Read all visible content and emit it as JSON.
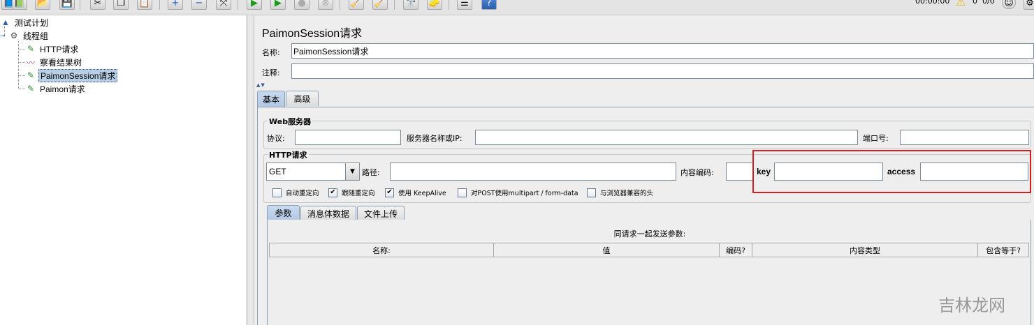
{
  "toolbar": {
    "buttons": [
      "templates-icon",
      "open-icon",
      "save-icon",
      "cut-icon",
      "copy-icon",
      "paste-icon",
      "expand-icon",
      "collapse-icon",
      "toggle-icon",
      "start-icon",
      "start-no-pause-icon",
      "stop-icon",
      "shutdown-icon",
      "clear-icon",
      "clear-all-icon",
      "search-icon",
      "reset-search-icon",
      "function-helper-icon",
      "help-icon"
    ],
    "timer": "00:00:00",
    "warning_count": "0",
    "thread_status": "0/0"
  },
  "tree": {
    "nodes": [
      {
        "label": "测试计划",
        "icon": "test-plan-icon"
      },
      {
        "label": "线程组",
        "icon": "gear-icon"
      },
      {
        "label": "HTTP请求",
        "icon": "pipette-icon"
      },
      {
        "label": "察看结果树",
        "icon": "chart-icon"
      },
      {
        "label": "PaimonSession请求",
        "icon": "pipette-icon",
        "selected": true
      },
      {
        "label": "Paimon请求",
        "icon": "pipette-icon"
      }
    ]
  },
  "panel": {
    "title": "PaimonSession请求",
    "name_label": "名称:",
    "name_value": "PaimonSession请求",
    "comment_label": "注释:",
    "comment_value": ""
  },
  "tabs": [
    "基本",
    "高级"
  ],
  "web_server": {
    "title": "Web服务器",
    "protocol_label": "协议:",
    "server_label": "服务器名称或IP:",
    "port_label": "端口号:"
  },
  "http_request": {
    "title": "HTTP请求",
    "method": "GET",
    "path_label": "路径:",
    "encoding_label": "内容编码:",
    "key_label": "key",
    "access_label": "access"
  },
  "checkboxes": [
    {
      "label": "自动重定向",
      "checked": false
    },
    {
      "label": "跟随重定向",
      "checked": true
    },
    {
      "label": "使用 KeepAlive",
      "checked": true
    },
    {
      "label": "对POST使用multipart / form-data",
      "checked": false
    },
    {
      "label": "与浏览器兼容的头",
      "checked": false
    }
  ],
  "param_tabs": [
    "参数",
    "消息体数据",
    "文件上传"
  ],
  "params_table": {
    "title": "同请求一起发送参数:",
    "columns": [
      "名称:",
      "值",
      "编码?",
      "内容类型",
      "包含等于?"
    ]
  },
  "watermark": "吉林龙网",
  "colors": {
    "highlight_box": "#d22020",
    "selection": "#b8cfe5"
  }
}
